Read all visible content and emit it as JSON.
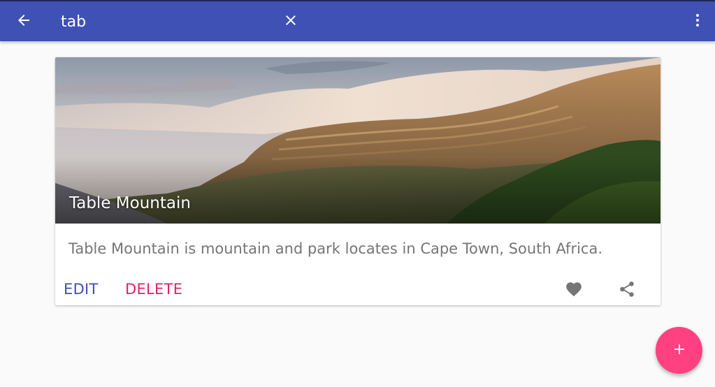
{
  "toolbar": {
    "back_icon": "arrow-back-icon",
    "search_value": "tab",
    "clear_icon": "close-icon",
    "overflow_icon": "more-vert-icon",
    "color": "#3f51b5"
  },
  "card": {
    "title": "Table Mountain",
    "description": "Table Mountain is mountain and park locates in Cape Town, South Africa.",
    "edit_label": "EDIT",
    "delete_label": "DELETE",
    "favorite_icon": "heart-icon",
    "share_icon": "share-icon",
    "edit_color": "#3f51b5",
    "delete_color": "#e91e63"
  },
  "fab": {
    "icon": "plus-icon",
    "color": "#ff4081"
  }
}
